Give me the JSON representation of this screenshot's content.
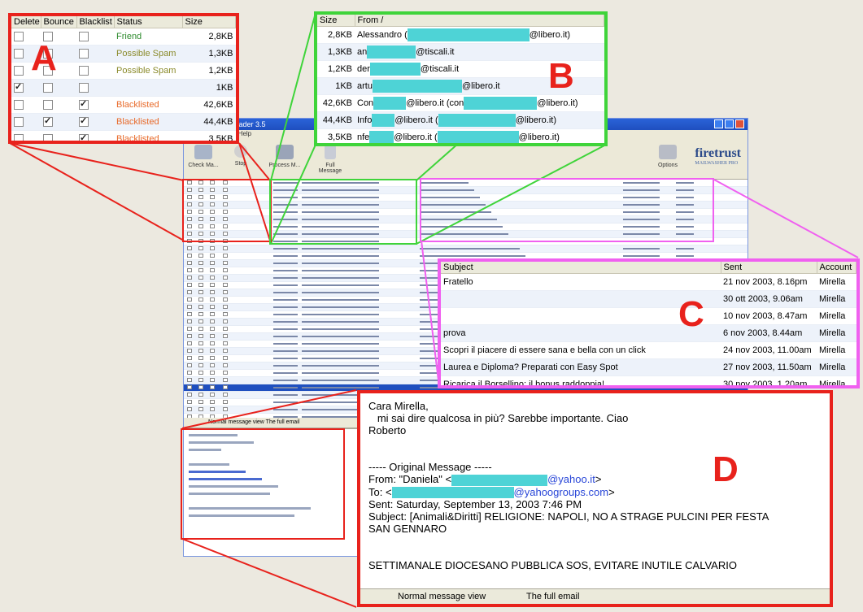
{
  "colors": {
    "callout_red": "#e8221c",
    "callout_green": "#3fd43a",
    "callout_pink": "#f060f0",
    "redacted": "#4ed3d6",
    "friend": "#2e8b2e",
    "possible_spam": "#8a8a2a",
    "blacklisted": "#e86a2a",
    "link_blue": "#2846d8"
  },
  "labels": {
    "A": "A",
    "B": "B",
    "C": "C",
    "D": "D"
  },
  "app": {
    "title_fragment": "...ader 3.5",
    "menu_fragment": "...Help",
    "toolbar": [
      {
        "label": "Check Ma...",
        "icon": "mail-check-icon"
      },
      {
        "label": "Stop",
        "icon": "stop-icon"
      },
      {
        "label": "Process M...",
        "icon": "process-icon"
      },
      {
        "label": "Full Message",
        "icon": "document-icon"
      },
      {
        "label": "Options",
        "icon": "printer-options-icon"
      }
    ],
    "logo": "firetrust",
    "logo_sub": "MAILWASHER PRO",
    "preview_tabs": "Normal message view     The full email"
  },
  "panel_a": {
    "headers": [
      "Delete",
      "Bounce",
      "Blacklist",
      "Status",
      "Size"
    ],
    "rows": [
      {
        "delete": false,
        "bounce": false,
        "blacklist": false,
        "status": "Friend",
        "status_type": "friend",
        "size": "2,8KB"
      },
      {
        "delete": false,
        "bounce": false,
        "blacklist": false,
        "status": "Possible Spam",
        "status_type": "poss",
        "size": "1,3KB"
      },
      {
        "delete": false,
        "bounce": false,
        "blacklist": false,
        "status": "Possible Spam",
        "status_type": "poss",
        "size": "1,2KB"
      },
      {
        "delete": true,
        "bounce": false,
        "blacklist": false,
        "status": "",
        "status_type": "none",
        "size": "1KB"
      },
      {
        "delete": false,
        "bounce": false,
        "blacklist": true,
        "status": "Blacklisted",
        "status_type": "black",
        "size": "42,6KB"
      },
      {
        "delete": false,
        "bounce": true,
        "blacklist": true,
        "status": "Blacklisted",
        "status_type": "black",
        "size": "44,4KB"
      },
      {
        "delete": false,
        "bounce": false,
        "blacklist": true,
        "status": "Blacklisted",
        "status_type": "black",
        "size": "3,5KB"
      }
    ]
  },
  "panel_b": {
    "headers": [
      "Size",
      "From"
    ],
    "rows": [
      {
        "size": "2,8KB",
        "pre": "Alessandro (",
        "mask": 150,
        "post": "@libero.it)"
      },
      {
        "size": "1,3KB",
        "pre": "an",
        "mask": 60,
        "post": "@tiscali.it"
      },
      {
        "size": "1,2KB",
        "pre": "der",
        "mask": 62,
        "post": "@tiscali.it"
      },
      {
        "size": "1KB",
        "pre": "artu",
        "mask": 110,
        "post": "@libero.it"
      },
      {
        "size": "42,6KB",
        "pre": "Con",
        "mask": 40,
        "post": "@libero.it (con",
        "mask2": 90,
        "post2": "@libero.it)"
      },
      {
        "size": "44,4KB",
        "pre": "Info",
        "mask": 28,
        "post": "@libero.it (",
        "mask2": 95,
        "post2": "@libero.it)"
      },
      {
        "size": "3,5KB",
        "pre": "nfe",
        "mask": 30,
        "post": "@libero.it (",
        "mask2": 100,
        "post2": "@libero.it)"
      }
    ]
  },
  "panel_c": {
    "headers": [
      "Subject",
      "Sent",
      "Account"
    ],
    "rows": [
      {
        "subject": "Fratello",
        "sent": "21 nov 2003, 8.16pm",
        "account": "Mirella"
      },
      {
        "subject": "",
        "sent": "30 ott 2003, 9.06am",
        "account": "Mirella"
      },
      {
        "subject": "",
        "sent": "10 nov 2003, 8.47am",
        "account": "Mirella"
      },
      {
        "subject": "prova",
        "sent": "6 nov 2003, 8.44am",
        "account": "Mirella"
      },
      {
        "subject": "Scopri il piacere di essere sana e bella con un click",
        "sent": "24 nov 2003, 11.00am",
        "account": "Mirella"
      },
      {
        "subject": "Laurea e Diploma? Preparati con Easy Spot",
        "sent": "27 nov 2003, 11.50am",
        "account": "Mirella"
      },
      {
        "subject": "Ricarica il Borsellino: il bonus raddoppia!",
        "sent": "30 nov 2003, 1.20am",
        "account": "Mirella"
      }
    ]
  },
  "panel_d": {
    "greeting": "Cara Mirella,",
    "line1": "   mi sai dire qualcosa in più? Sarebbe importante. Ciao",
    "sign": "Roberto",
    "orig": "----- Original Message -----",
    "from_label": "From: \"Daniela\" <",
    "from_domain": "@yahoo.it",
    "to_label": "To: <",
    "to_domain": "@yahoogroups.com",
    "sent": "Sent: Saturday, September 13, 2003 7:46 PM",
    "subject1": "Subject: [Animali&Diritti] RELIGIONE: NAPOLI, NO A STRAGE PULCINI PER FESTA",
    "subject2": "SAN GENNARO",
    "body": "SETTIMANALE DIOCESANO PUBBLICA SOS, EVITARE INUTILE CALVARIO",
    "tab1": "Normal message view",
    "tab2": "The full email"
  }
}
